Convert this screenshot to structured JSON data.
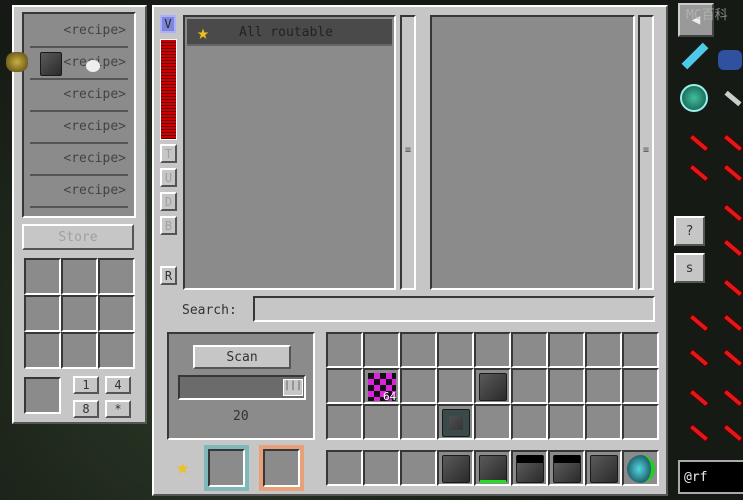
{
  "left_panel": {
    "recipes": [
      "<recipe>",
      "<recipe>",
      "<recipe>",
      "<recipe>",
      "<recipe>",
      "<recipe>"
    ],
    "store_label": "Store",
    "amount_buttons": [
      "1",
      "4",
      "8",
      "*"
    ]
  },
  "main": {
    "side_buttons": {
      "v": "V",
      "t": "T",
      "u": "U",
      "d": "D",
      "b": "B",
      "r": "R"
    },
    "energy_level": 1.0,
    "list_header": "All routable",
    "search_label": "Search:",
    "search_value": "",
    "scan_label": "Scan",
    "scan_value": "20",
    "stack_count": "64"
  },
  "right_side": {
    "help_label": "?",
    "s_label": "s",
    "watermark": "MC百科",
    "filter_value": "@rf"
  },
  "colors": {
    "panel": "#c6c6c6",
    "slot": "#8b8b8b",
    "energy": "#c00000",
    "cyan_slot": "#7fb8b8",
    "orange_slot": "#e8a078"
  }
}
